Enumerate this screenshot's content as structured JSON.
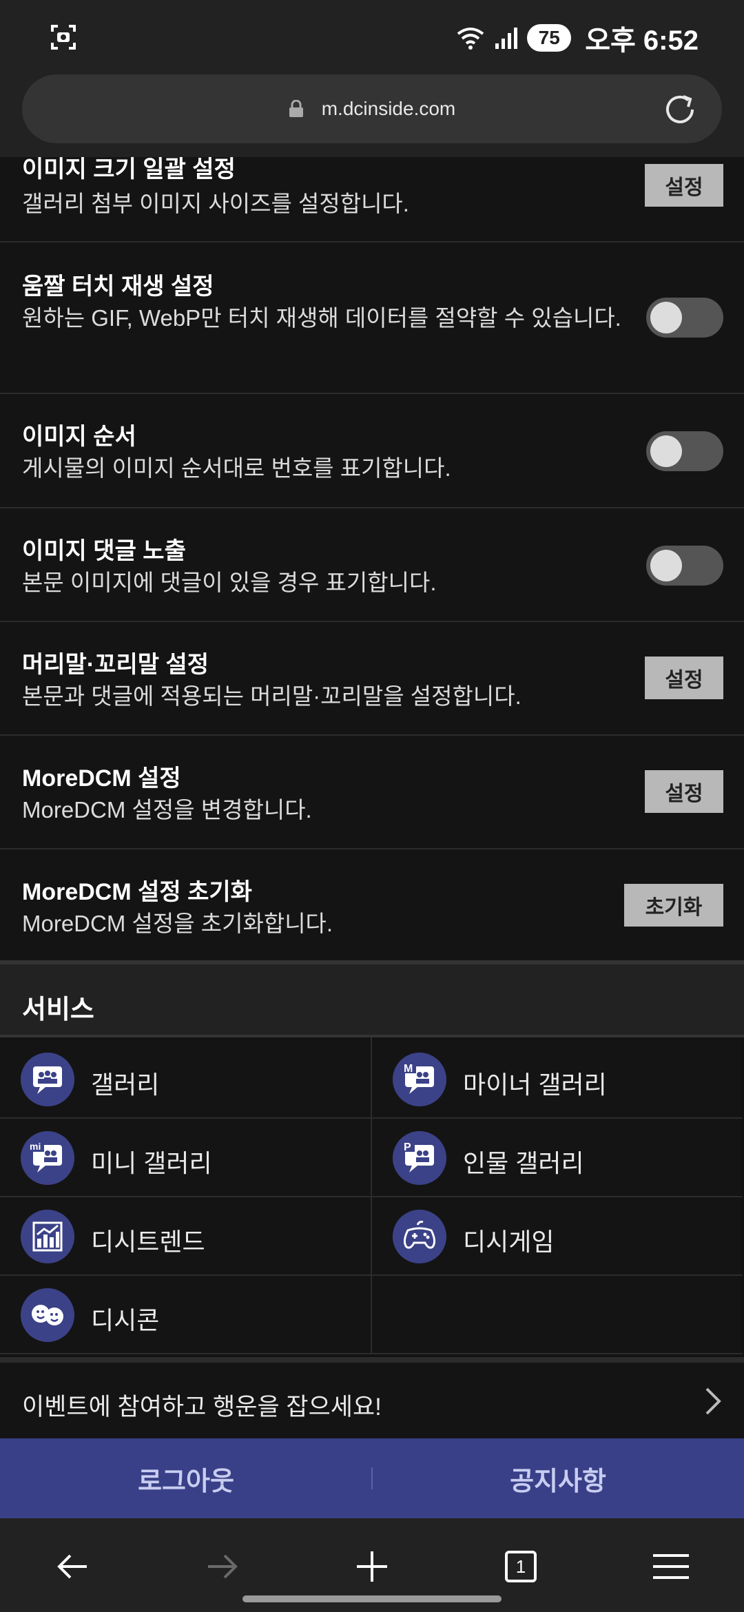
{
  "status_bar": {
    "battery": "75",
    "time": "오후 6:52"
  },
  "browser": {
    "url": "m.dcinside.com"
  },
  "settings": [
    {
      "title": "이미지 크기 일괄 설정",
      "desc": "갤러리 첨부 이미지 사이즈를 설정합니다.",
      "control": "button",
      "button_label": "설정"
    },
    {
      "title": "움짤 터치 재생 설정",
      "desc": "원하는 GIF, WebP만 터치 재생해 데이터를 절약할 수 있습니다.",
      "control": "toggle",
      "on": false
    },
    {
      "title": "이미지 순서",
      "desc": "게시물의 이미지 순서대로 번호를 표기합니다.",
      "control": "toggle",
      "on": false
    },
    {
      "title": "이미지 댓글 노출",
      "desc": "본문 이미지에 댓글이 있을 경우 표기합니다.",
      "control": "toggle",
      "on": false
    },
    {
      "title": "머리말·꼬리말 설정",
      "desc": "본문과 댓글에 적용되는 머리말·꼬리말을 설정합니다.",
      "control": "button",
      "button_label": "설정"
    },
    {
      "title": "MoreDCM 설정",
      "desc": "MoreDCM 설정을 변경합니다.",
      "control": "button",
      "button_label": "설정"
    },
    {
      "title": "MoreDCM 설정 초기화",
      "desc": "MoreDCM 설정을 초기화합니다.",
      "control": "button",
      "button_label": "초기화"
    }
  ],
  "services": {
    "header": "서비스",
    "items": [
      {
        "label": "갤러리",
        "icon": "gallery-icon"
      },
      {
        "label": "마이너 갤러리",
        "icon": "minor-gallery-icon"
      },
      {
        "label": "미니 갤러리",
        "icon": "mini-gallery-icon"
      },
      {
        "label": "인물 갤러리",
        "icon": "person-gallery-icon"
      },
      {
        "label": "디시트렌드",
        "icon": "trend-chart-icon"
      },
      {
        "label": "디시게임",
        "icon": "gamepad-icon"
      },
      {
        "label": "디시콘",
        "icon": "dccon-faces-icon"
      }
    ]
  },
  "event_banner": "이벤트에 참여하고 행운을 잡으세요!",
  "bottom_bar": {
    "logout": "로그아웃",
    "notice": "공지사항"
  },
  "nav": {
    "tab_count": "1"
  }
}
